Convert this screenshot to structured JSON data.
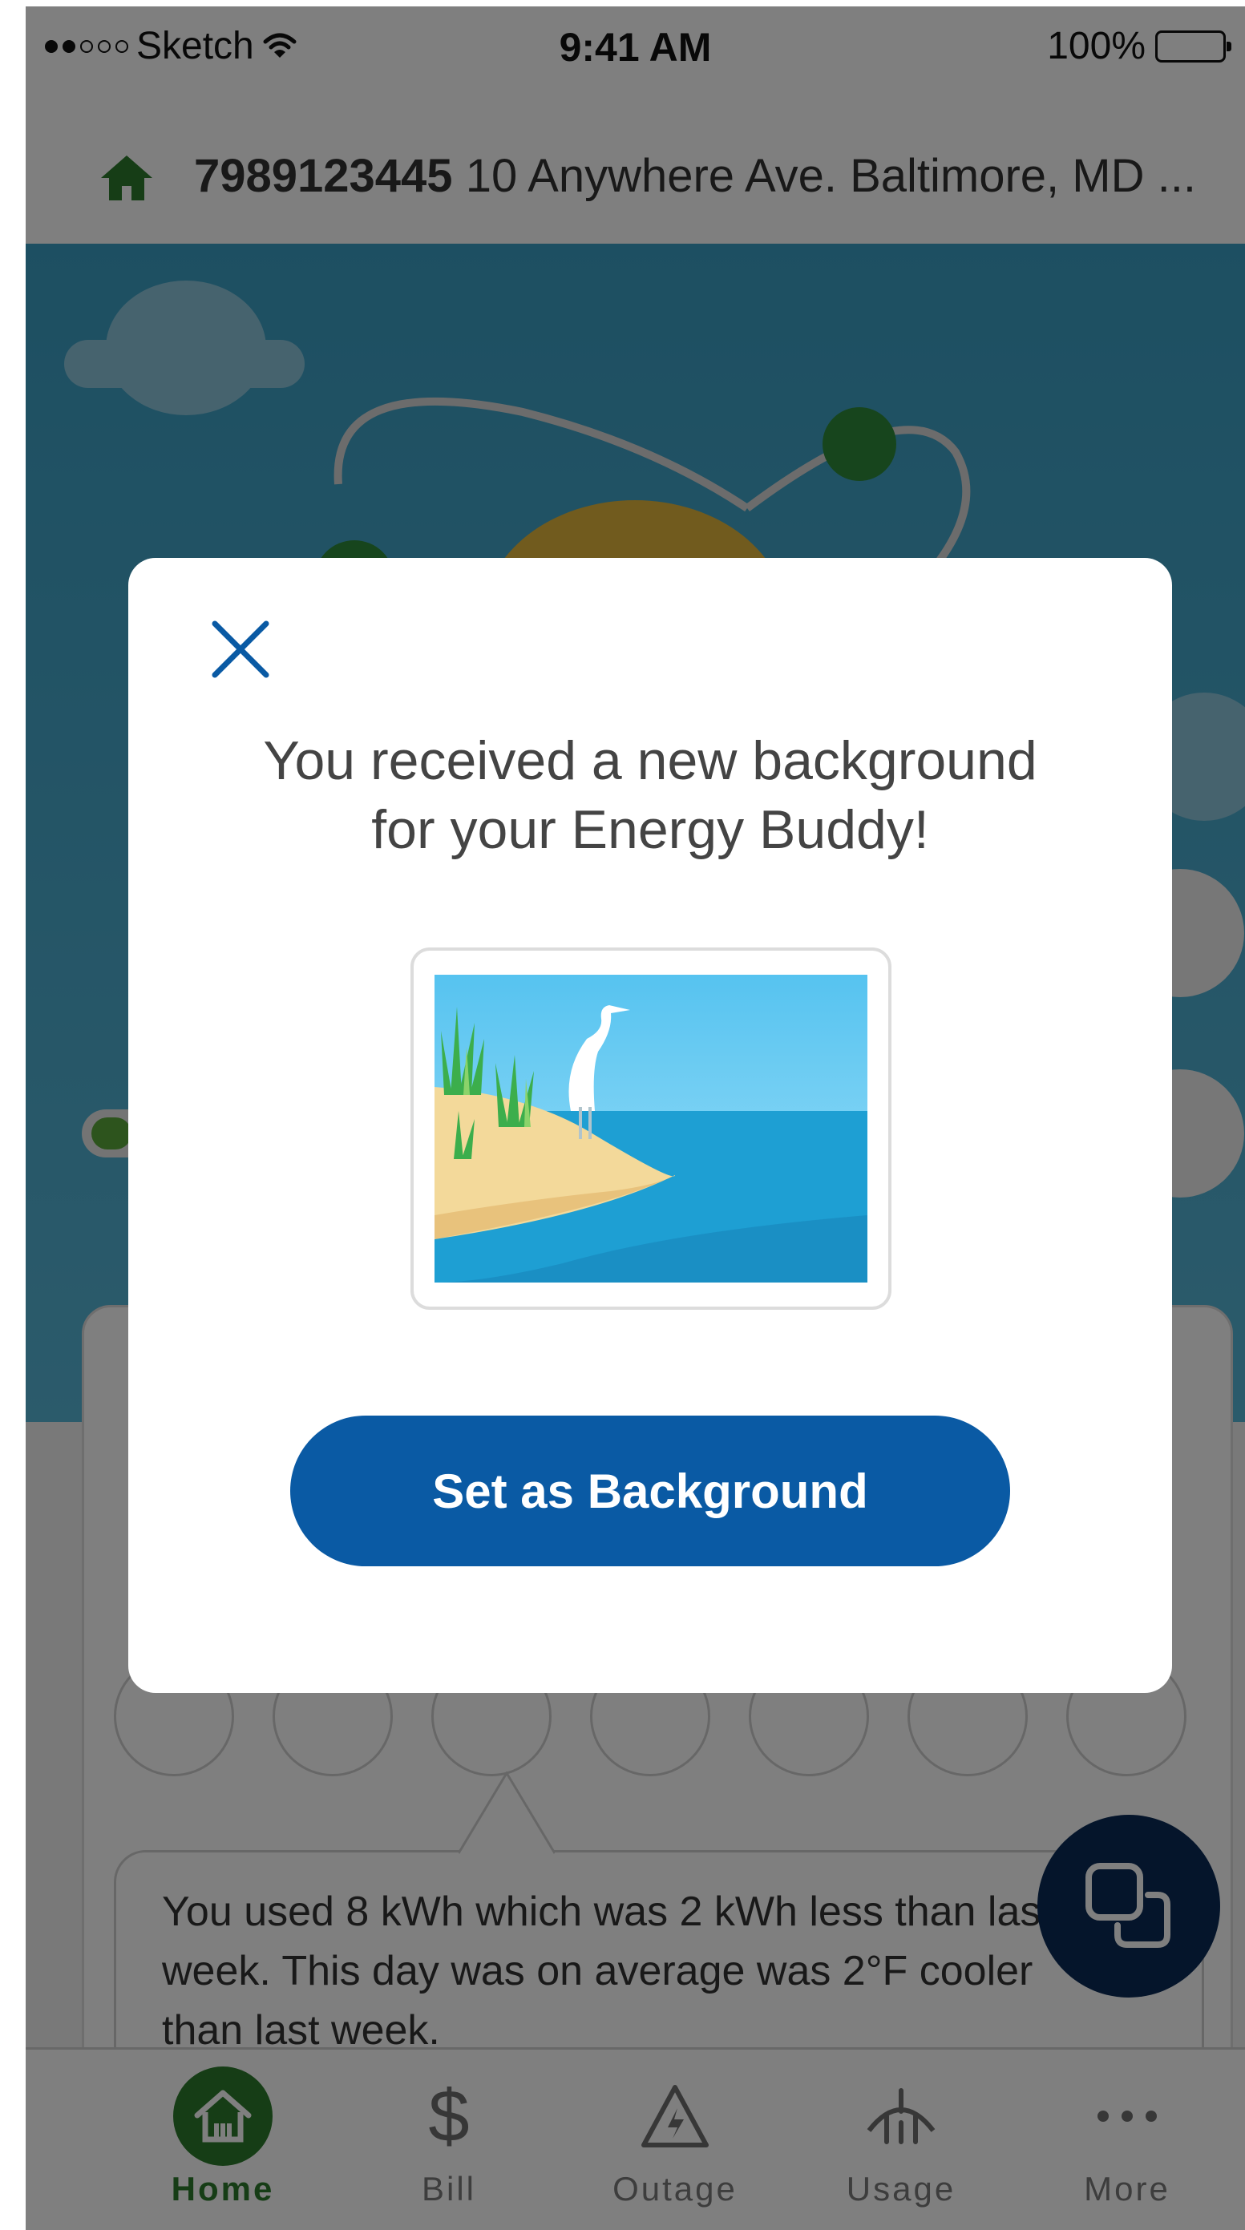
{
  "status_bar": {
    "carrier": "Sketch",
    "time": "9:41 AM",
    "battery": "100%",
    "signal_icon": "signal-dots-icon",
    "wifi_icon": "wifi-icon",
    "battery_icon": "battery-icon"
  },
  "account": {
    "number": "7989123445",
    "address": "10 Anywhere Ave. Baltimore, MD ...",
    "icon": "home-icon"
  },
  "usage": {
    "message": "You used 8 kWh which was 2 kWh less than last week. This day was on average was 2°F cooler than last week."
  },
  "modal": {
    "title_line1": "You received a new background",
    "title_line2": "for your Energy Buddy!",
    "button_label": "Set as Background",
    "close_icon": "close-icon",
    "thumbnail_icon": "beach-heron-background-image"
  },
  "tabs": [
    {
      "label": "Home",
      "icon": "home-icon",
      "active": true
    },
    {
      "label": "Bill",
      "icon": "dollar-icon",
      "active": false
    },
    {
      "label": "Outage",
      "icon": "outage-warning-icon",
      "active": false
    },
    {
      "label": "Usage",
      "icon": "usage-meter-icon",
      "active": false
    },
    {
      "label": "More",
      "icon": "more-dots-icon",
      "active": false
    }
  ],
  "fab": {
    "icon": "overlapping-squares-icon"
  },
  "colors": {
    "brand_green": "#2d7a2d",
    "primary_blue": "#0a5aa4",
    "fab_navy": "#0b2a56",
    "sky_blue": "#3b9fc4"
  }
}
